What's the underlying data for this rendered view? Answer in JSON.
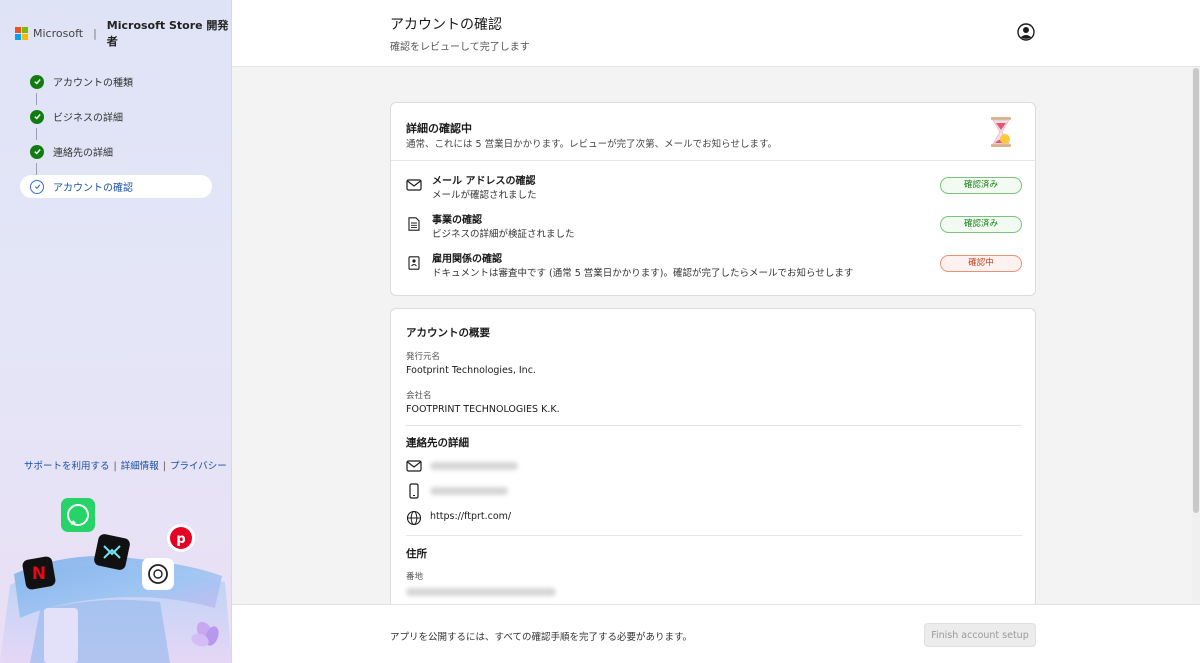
{
  "brand": {
    "microsoft": "Microsoft",
    "separator": "|",
    "store_dev": "Microsoft Store 開発者",
    "logo_colors": [
      "#f25022",
      "#7fba00",
      "#00a4ef",
      "#ffb900"
    ]
  },
  "sidebar": {
    "steps": [
      {
        "label": "アカウントの種類",
        "status": "complete"
      },
      {
        "label": "ビジネスの詳細",
        "status": "complete"
      },
      {
        "label": "連絡先の詳細",
        "status": "complete"
      },
      {
        "label": "アカウントの確認",
        "status": "current"
      }
    ],
    "links": {
      "support": "サポートを利用する",
      "details": "詳細情報",
      "privacy": "プライバシー",
      "sep": "|"
    },
    "illustration_icons": [
      "whatsapp-icon",
      "pinterest-icon",
      "netflix-icon",
      "capcut-icon",
      "chatgpt-icon"
    ]
  },
  "header": {
    "title": "アカウントの確認",
    "subtitle": "確認をレビューして完了します"
  },
  "verification": {
    "title": "詳細の確認中",
    "description": "通常、これには 5 営業日かかります。レビューが完了次第、メールでお知らせします。",
    "items": [
      {
        "title": "メール アドレスの確認",
        "desc": "メールが確認されました",
        "status": "確認済み",
        "state": "ok"
      },
      {
        "title": "事業の確認",
        "desc": "ビジネスの詳細が検証されました",
        "status": "確認済み",
        "state": "ok"
      },
      {
        "title": "雇用関係の確認",
        "desc": "ドキュメントは審査中です (通常 5 営業日かかります)。確認が完了したらメールでお知らせします",
        "status": "確認中",
        "state": "pending"
      }
    ]
  },
  "summary": {
    "title": "アカウントの概要",
    "publisher_label": "発行元名",
    "publisher_value": "Footprint Technologies, Inc.",
    "company_label": "会社名",
    "company_value": "FOOTPRINT TECHNOLOGIES K.K.",
    "contact_title": "連絡先の詳細",
    "website": "https://ftprt.com/",
    "address_title": "住所",
    "street_label": "番地"
  },
  "footer": {
    "note": "アプリを公開するには、すべての確認手順を完了する必要があります。",
    "finish_button": "Finish account setup"
  },
  "colors": {
    "accent": "#1a4fa3",
    "success": "#107c10",
    "warning": "#c43e1c"
  }
}
